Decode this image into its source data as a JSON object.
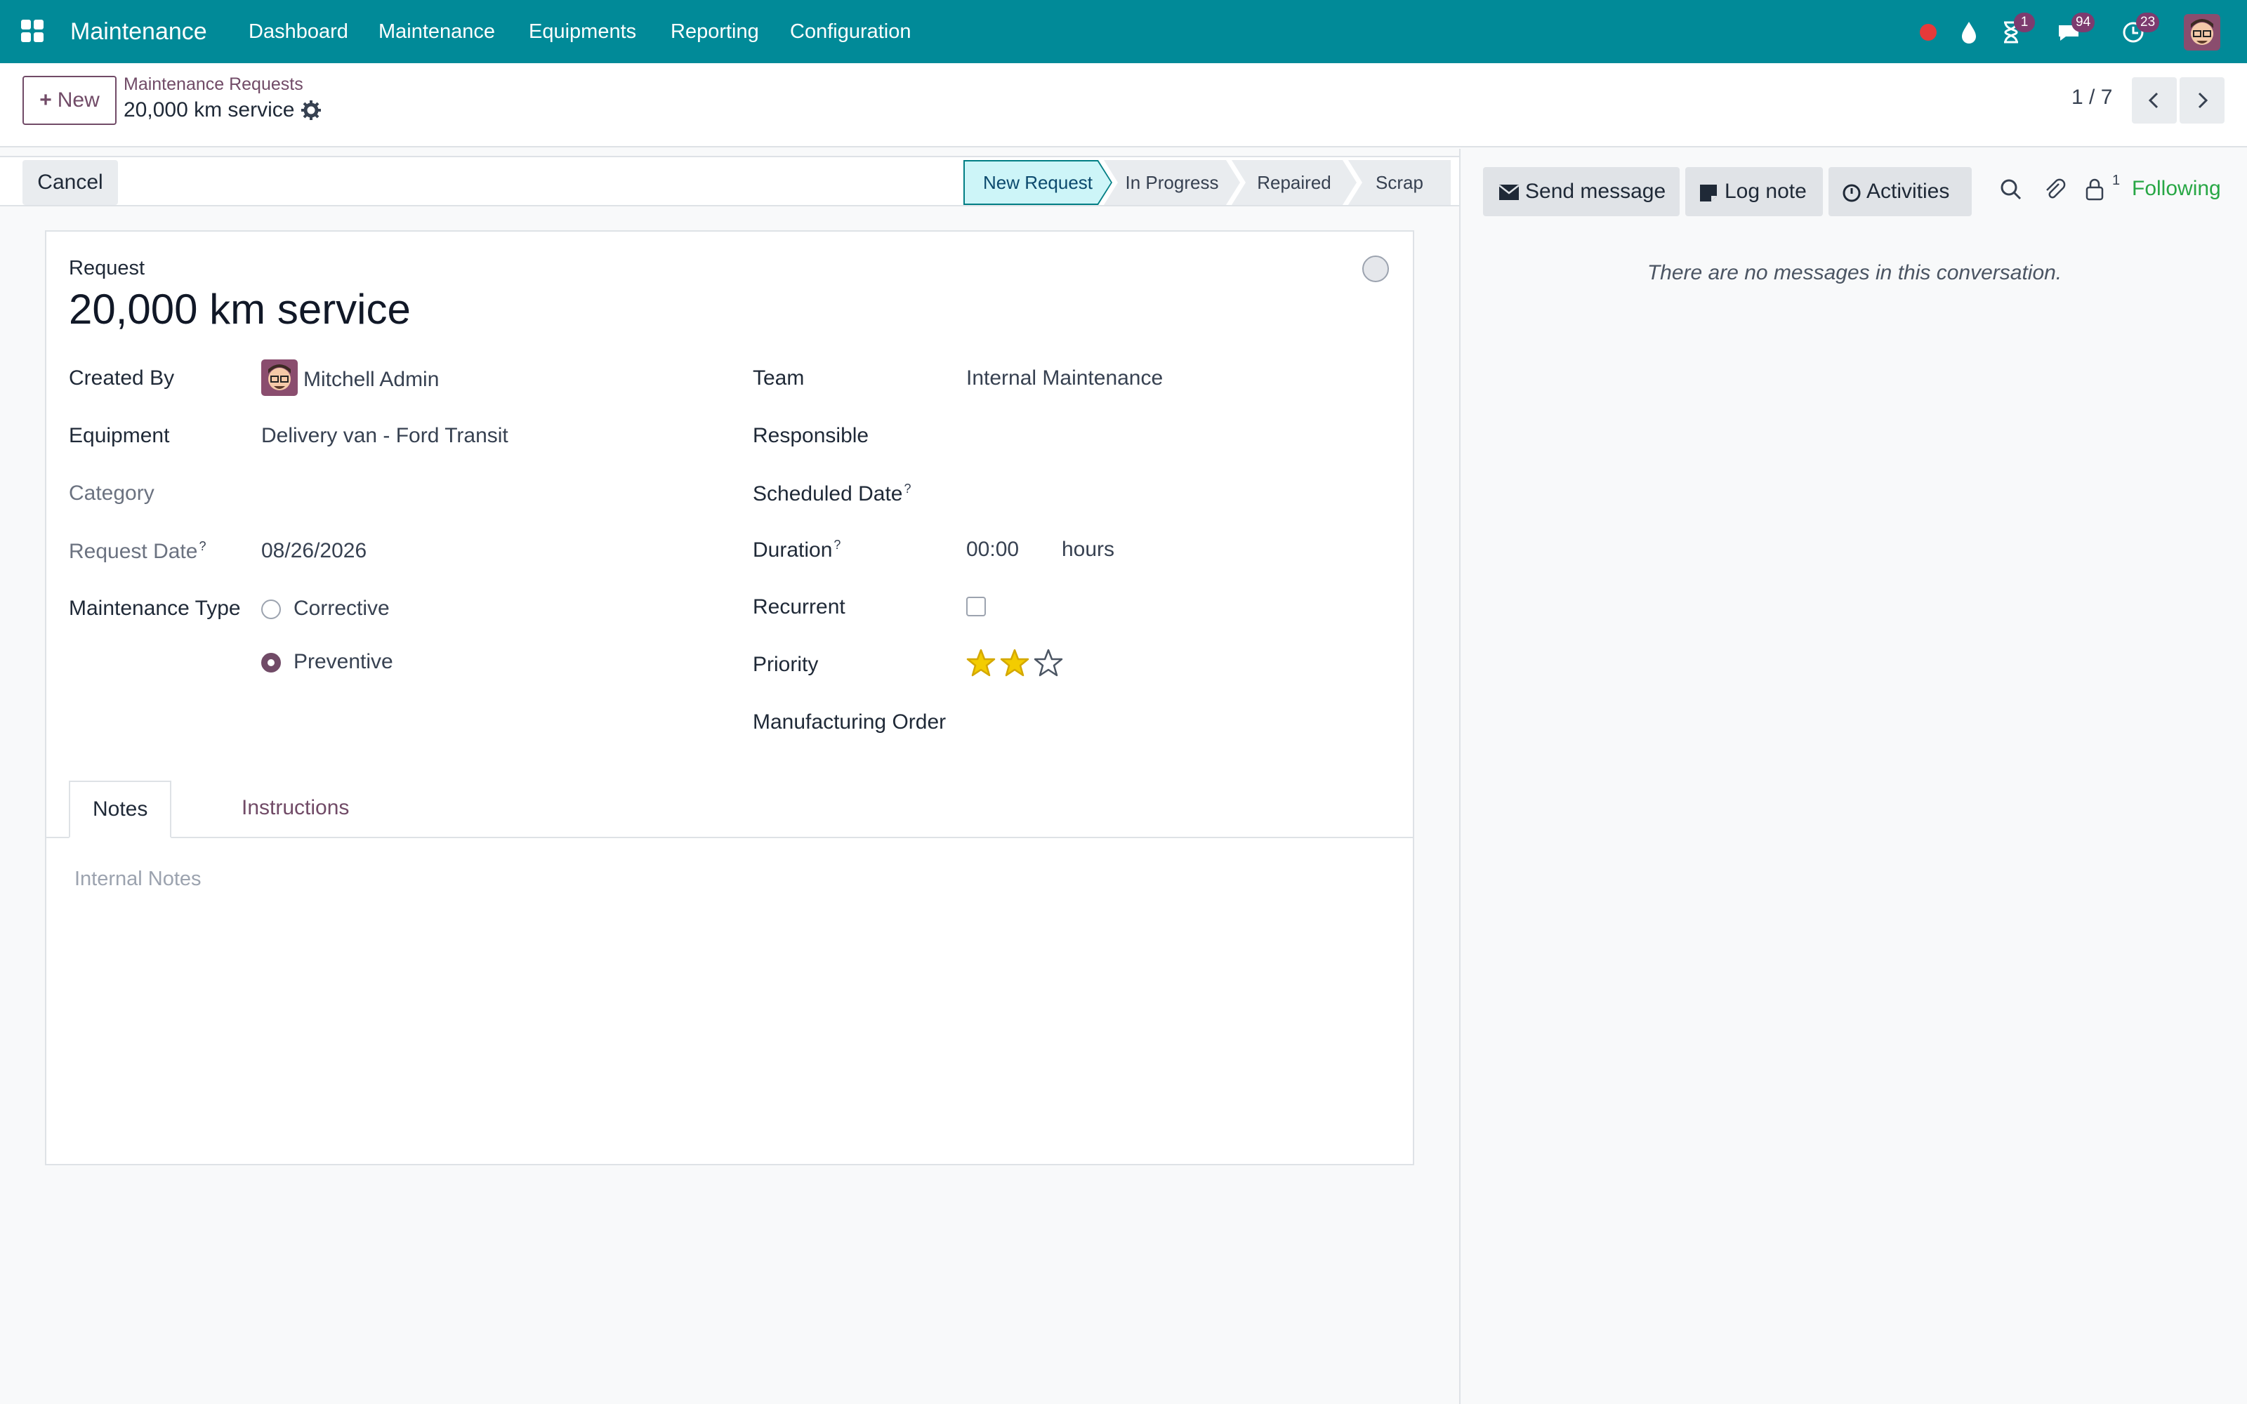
{
  "navbar": {
    "app_name": "Maintenance",
    "menu": [
      "Dashboard",
      "Maintenance",
      "Equipments",
      "Reporting",
      "Configuration"
    ],
    "badges": {
      "activities": "1",
      "messages": "94",
      "clock": "23"
    },
    "icons": [
      "apps-grid-icon",
      "record-dot-icon",
      "drop-icon",
      "hourglass-icon",
      "chat-icon",
      "clock-icon",
      "user-avatar"
    ],
    "colors": {
      "bar": "#018a98",
      "badge": "#7d3b6f"
    }
  },
  "control_panel": {
    "new_label": "New",
    "breadcrumb_parent": "Maintenance Requests",
    "breadcrumb_current": "20,000 km service",
    "pager": "1 / 7"
  },
  "statusbar": {
    "cancel_label": "Cancel",
    "stages": [
      "New Request",
      "In Progress",
      "Repaired",
      "Scrap"
    ],
    "active_stage": "New Request"
  },
  "form": {
    "title_label": "Request",
    "title": "20,000 km service",
    "left": {
      "created_by_label": "Created By",
      "created_by": "Mitchell Admin",
      "equipment_label": "Equipment",
      "equipment": "Delivery van - Ford Transit",
      "category_label": "Category",
      "request_date_label": "Request Date",
      "request_date": "08/26/2026",
      "maintenance_type_label": "Maintenance Type",
      "maintenance_type_options": [
        "Corrective",
        "Preventive"
      ],
      "maintenance_type_selected": "Preventive"
    },
    "right": {
      "team_label": "Team",
      "team": "Internal Maintenance",
      "responsible_label": "Responsible",
      "scheduled_date_label": "Scheduled Date",
      "duration_label": "Duration",
      "duration": "00:00",
      "duration_unit": "hours",
      "recurrent_label": "Recurrent",
      "recurrent": false,
      "priority_label": "Priority",
      "priority_stars": 2,
      "priority_max": 3,
      "manufacturing_order_label": "Manufacturing Order"
    },
    "help_mark": "?",
    "tabs": [
      "Notes",
      "Instructions"
    ],
    "active_tab": "Notes",
    "notes_placeholder": "Internal Notes"
  },
  "chatter": {
    "send_message": "Send message",
    "log_note": "Log note",
    "activities": "Activities",
    "followers_count": "1",
    "following": "Following",
    "empty_text": "There are no messages in this conversation."
  },
  "colors": {
    "primary": "#714b67",
    "star": "#f3cc00",
    "following": "#28a745",
    "active_stage_bg": "#cdf5f8"
  }
}
